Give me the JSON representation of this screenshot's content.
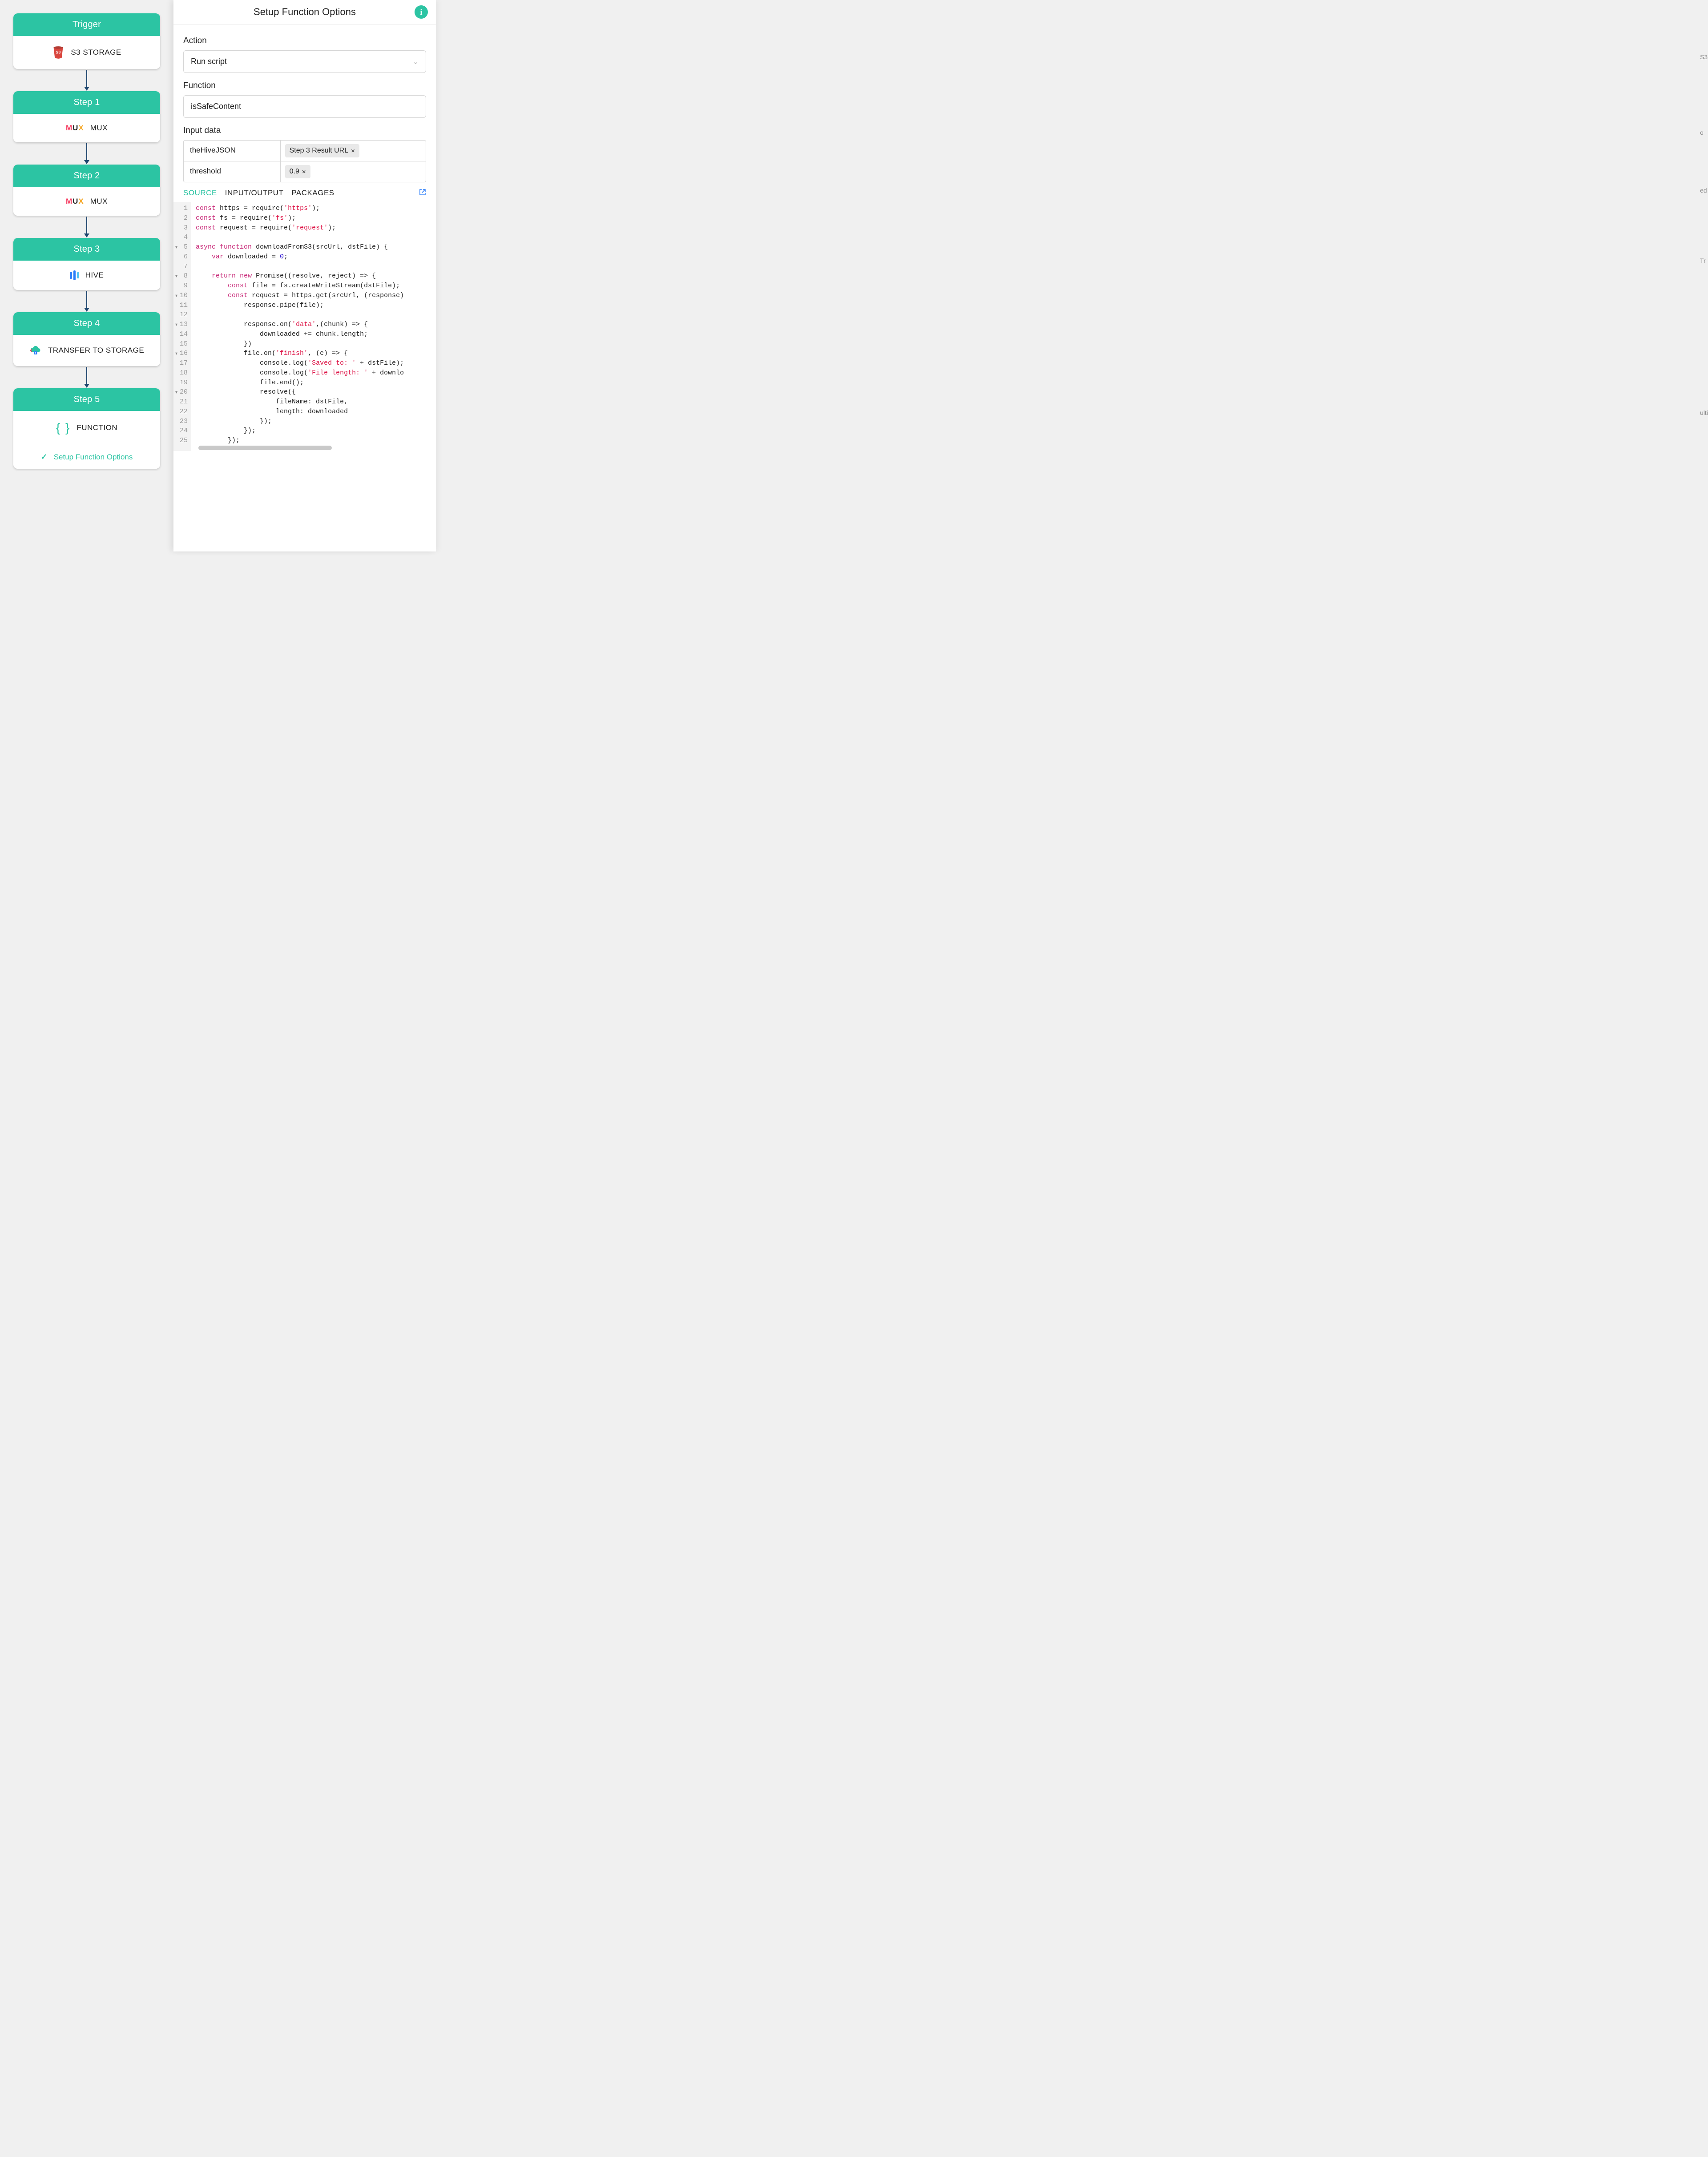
{
  "workflow": {
    "trigger": {
      "title": "Trigger",
      "service": "S3 STORAGE"
    },
    "steps": [
      {
        "title": "Step 1",
        "service": "MUX",
        "icon": "mux"
      },
      {
        "title": "Step 2",
        "service": "MUX",
        "icon": "mux"
      },
      {
        "title": "Step 3",
        "service": "HIVE",
        "icon": "hive"
      },
      {
        "title": "Step 4",
        "service": "TRANSFER TO STORAGE",
        "icon": "transfer"
      },
      {
        "title": "Step 5",
        "service": "FUNCTION",
        "icon": "braces",
        "substep": {
          "label": "Setup Function Options",
          "checked": true
        }
      }
    ]
  },
  "panel": {
    "title": "Setup Function Options",
    "action_label": "Action",
    "action_value": "Run script",
    "function_label": "Function",
    "function_value": "isSafeContent",
    "input_label": "Input data",
    "inputs": [
      {
        "key": "theHiveJSON",
        "chip": "Step 3 Result URL"
      },
      {
        "key": "threshold",
        "chip": "0.9"
      }
    ],
    "tabs": {
      "source": "SOURCE",
      "io": "INPUT/OUTPUT",
      "packages": "PACKAGES"
    }
  },
  "code": {
    "lines": [
      "const https = require('https');",
      "const fs = require('fs');",
      "const request = require('request');",
      "",
      "async function downloadFromS3(srcUrl, dstFile) {",
      "    var downloaded = 0;",
      "",
      "    return new Promise((resolve, reject) => {",
      "        const file = fs.createWriteStream(dstFile);",
      "        const request = https.get(srcUrl, (response)",
      "            response.pipe(file);",
      "",
      "            response.on('data',(chunk) => {",
      "                downloaded += chunk.length;",
      "            })",
      "            file.on('finish', (e) => {",
      "                console.log('Saved to: ' + dstFile);",
      "                console.log('File length: ' + downlo",
      "                file.end();",
      "                resolve({",
      "                    fileName: dstFile,",
      "                    length: downloaded",
      "                });",
      "            });",
      "        });"
    ],
    "fold_lines": [
      5,
      8,
      10,
      13,
      16,
      20
    ]
  },
  "peeks": [
    "S3",
    "o",
    "ed",
    "Tr",
    "ulti"
  ]
}
